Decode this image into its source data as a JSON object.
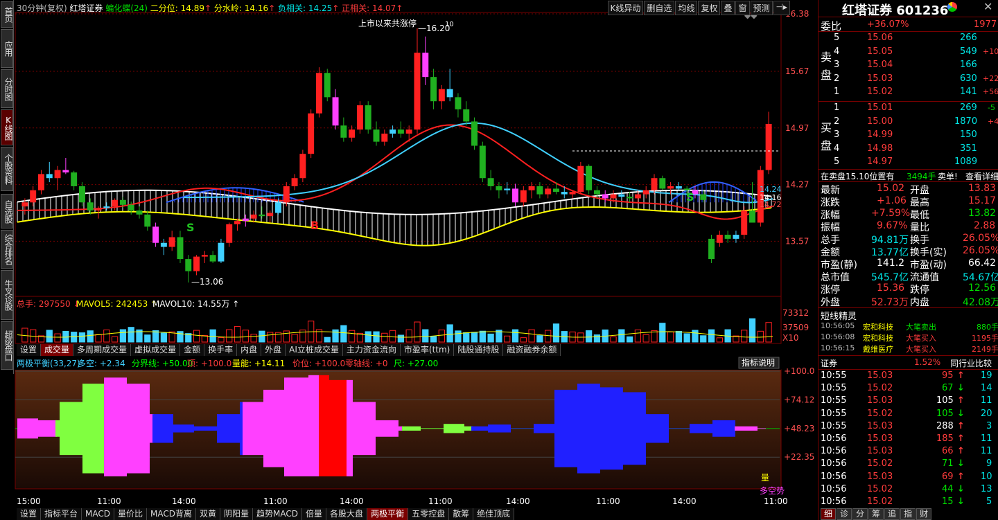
{
  "left_tabs": [
    "首页",
    "应用",
    "分时图",
    "K线图",
    "个股资料",
    "自选股",
    "综合排名",
    "牛叉诊股",
    "超级盘口"
  ],
  "header": {
    "period": "30分钟(复权)",
    "stock": "红塔证券",
    "butterfly": "蝙化蝶(24)",
    "erfen": "二分位: 14.89",
    "fenshui": "分水岭: 14.16",
    "fuxiang": "负相关: 14.25",
    "zhengxiang": "正相关: 14.07"
  },
  "top_buttons": [
    "K线异动",
    "删自选",
    "均线",
    "复权",
    "叠",
    "窗",
    "预测"
  ],
  "price_axis": [
    "16.38",
    "15.67",
    "14.97",
    "14.27",
    "13.57"
  ],
  "annotations": {
    "high": "16.20",
    "high_sup": "10",
    "low": "13.06",
    "listed": "上市以来共涨停",
    "right1": "14.24",
    "right2": "14.16",
    "right3": "14.72",
    "S1": "S",
    "S2": "S",
    "B": "B"
  },
  "volume": {
    "label": "总手: 297550",
    "mavol5": "MAVOL5: 242453",
    "mavol10": "MAVOL10: 14.55万",
    "axis1": "73312",
    "axis2": "37509",
    "axis3": "X10"
  },
  "mid_tabs": [
    "设置",
    "成交量",
    "多周期成交量",
    "虚拟成交量",
    "金额",
    "换手率",
    "内盘",
    "外盘",
    "AI立桩成交量",
    "主力资金流向",
    "市盈率(ttm)",
    "陆股通持股",
    "融资融券余额"
  ],
  "indicator": {
    "name": "两极平衡(33,27)",
    "duokong": "多空: +2.34",
    "fenjie": "分界线: +50.00",
    "ding": "顶: +100.0",
    "liangneng": "量能: +14.11",
    "jiawei": "价位: +100.0",
    "lingzhou": "零轴线: +0",
    "chi": "尺: +27.00",
    "explain": "指标说明",
    "axis": [
      "+100.0",
      "+74.12",
      "+48.23",
      "+22.35"
    ],
    "tag1": "量",
    "tag2": "多空势"
  },
  "time_axis": [
    "15:00",
    "11:00",
    "14:00",
    "11:00",
    "14:00",
    "11:00",
    "14:00",
    "11:00",
    "14:00",
    "11:00"
  ],
  "bottom_tabs": [
    "设置",
    "指标平台",
    "MACD",
    "量价比",
    "MACD背离",
    "双黄",
    "阴阳量",
    "趋势MACD",
    "倍量",
    "各股大盘",
    "两极平衡",
    "五零控盘",
    "散筹",
    "绝佳顶底"
  ],
  "right": {
    "title": "红塔证券 601236",
    "weibi": {
      "label": "委比",
      "pct": "+36.07%",
      "val": "1977"
    },
    "sell_label": "卖盘",
    "buy_label": "买盘",
    "asks": [
      [
        "5",
        "15.06",
        "266",
        ""
      ],
      [
        "4",
        "15.05",
        "549",
        "+10"
      ],
      [
        "3",
        "15.04",
        "166",
        ""
      ],
      [
        "2",
        "15.03",
        "630",
        "+22"
      ],
      [
        "1",
        "15.02",
        "141",
        "+56"
      ]
    ],
    "bids": [
      [
        "1",
        "15.01",
        "269",
        "-5"
      ],
      [
        "2",
        "15.00",
        "1870",
        "+4"
      ],
      [
        "3",
        "14.99",
        "150",
        ""
      ],
      [
        "4",
        "14.98",
        "351",
        ""
      ],
      [
        "5",
        "14.97",
        "1089",
        ""
      ]
    ],
    "note": "在卖盘15.10位置有",
    "note_val": "3494手",
    "note_tag": "卖单!",
    "note_link": "查看详细",
    "stats": [
      [
        "最新",
        "15.02",
        "开盘",
        "13.83"
      ],
      [
        "涨跌",
        "+1.06",
        "最高",
        "15.17"
      ],
      [
        "涨幅",
        "+7.59%",
        "最低",
        "13.82"
      ],
      [
        "振幅",
        "9.67%",
        "量比",
        "2.88"
      ],
      [
        "总手",
        "94.81万",
        "换手",
        "26.05%"
      ],
      [
        "金额",
        "13.77亿",
        "换手(实)",
        "26.05%"
      ],
      [
        "市盈(静)",
        "141.2",
        "市盈(动)",
        "66.42"
      ],
      [
        "总市值",
        "545.7亿",
        "流通值",
        "54.67亿"
      ],
      [
        "涨停",
        "15.36",
        "跌停",
        "12.56"
      ],
      [
        "外盘",
        "52.73万",
        "内盘",
        "42.08万"
      ]
    ],
    "elf_title": "短线精灵",
    "elf": [
      [
        "10:56:05",
        "宏和科技",
        "大笔卖出",
        "880手"
      ],
      [
        "10:56:08",
        "宏和科技",
        "大笔买入",
        "1195手"
      ],
      [
        "10:56:15",
        "戴维医疗",
        "大笔买入",
        "2149手"
      ]
    ],
    "sector": {
      "name": "证券",
      "pct": "1.52%",
      "link": "同行业比较"
    },
    "ticks": [
      [
        "10:55",
        "15.03",
        "95",
        "19"
      ],
      [
        "10:55",
        "15.02",
        "67",
        "14"
      ],
      [
        "10:55",
        "15.03",
        "105",
        "11"
      ],
      [
        "10:55",
        "15.02",
        "105",
        "20"
      ],
      [
        "10:55",
        "15.03",
        "288",
        "3"
      ],
      [
        "10:56",
        "15.03",
        "185",
        "11"
      ],
      [
        "10:56",
        "15.03",
        "66",
        "11"
      ],
      [
        "10:56",
        "15.02",
        "71",
        "9"
      ],
      [
        "10:56",
        "15.03",
        "69",
        "10"
      ],
      [
        "10:56",
        "15.02",
        "44",
        "13"
      ],
      [
        "10:56",
        "15.02",
        "15",
        "5"
      ]
    ],
    "bottom_tabs": [
      "细",
      "诊",
      "分",
      "筹",
      "追",
      "指",
      "财"
    ]
  },
  "chart_data": {
    "type": "candlestick",
    "ylim": [
      13.0,
      16.38
    ],
    "candles": [
      [
        14.0,
        14.1,
        13.9,
        14.05
      ],
      [
        14.05,
        14.25,
        14.0,
        14.2
      ],
      [
        14.2,
        14.45,
        14.15,
        14.4
      ],
      [
        14.4,
        14.55,
        14.3,
        14.35
      ],
      [
        14.35,
        14.5,
        14.2,
        14.45
      ],
      [
        14.45,
        14.6,
        14.4,
        14.42
      ],
      [
        14.42,
        14.44,
        14.2,
        14.25
      ],
      [
        14.25,
        14.3,
        14.0,
        14.05
      ],
      [
        14.05,
        14.1,
        13.9,
        13.95
      ],
      [
        13.95,
        14.0,
        13.85,
        13.98
      ],
      [
        13.98,
        14.05,
        13.95,
        14.0
      ],
      [
        14.0,
        14.1,
        13.95,
        14.08
      ],
      [
        14.08,
        14.12,
        13.98,
        14.02
      ],
      [
        14.02,
        14.06,
        13.9,
        13.95
      ],
      [
        13.95,
        14.0,
        13.85,
        13.9
      ],
      [
        13.9,
        13.95,
        13.7,
        13.75
      ],
      [
        13.75,
        13.8,
        13.5,
        13.55
      ],
      [
        13.55,
        13.6,
        13.4,
        13.5
      ],
      [
        13.5,
        13.7,
        13.45,
        13.62
      ],
      [
        13.62,
        13.7,
        13.3,
        13.35
      ],
      [
        13.35,
        13.4,
        13.06,
        13.2
      ],
      [
        13.2,
        13.4,
        13.15,
        13.38
      ],
      [
        13.38,
        13.45,
        13.3,
        13.4
      ],
      [
        13.4,
        13.45,
        13.3,
        13.32
      ],
      [
        13.32,
        13.6,
        13.3,
        13.55
      ],
      [
        13.55,
        13.8,
        13.5,
        13.78
      ],
      [
        13.78,
        13.85,
        13.7,
        13.82
      ],
      [
        13.82,
        13.9,
        13.75,
        13.85
      ],
      [
        13.85,
        13.95,
        13.8,
        13.9
      ],
      [
        13.9,
        14.0,
        13.85,
        13.88
      ],
      [
        13.88,
        13.95,
        13.8,
        13.92
      ],
      [
        13.92,
        14.1,
        13.9,
        14.05
      ],
      [
        14.05,
        14.3,
        14.0,
        14.25
      ],
      [
        14.25,
        14.4,
        14.2,
        14.35
      ],
      [
        14.35,
        14.7,
        14.3,
        14.65
      ],
      [
        14.65,
        15.2,
        14.6,
        15.15
      ],
      [
        15.15,
        15.72,
        15.1,
        15.65
      ],
      [
        15.65,
        15.7,
        15.3,
        15.35
      ],
      [
        15.35,
        15.45,
        14.95,
        15.0
      ],
      [
        15.0,
        15.1,
        14.8,
        14.85
      ],
      [
        14.85,
        15.0,
        14.8,
        14.95
      ],
      [
        14.95,
        15.3,
        14.9,
        15.25
      ],
      [
        15.25,
        15.3,
        14.9,
        14.95
      ],
      [
        14.95,
        15.05,
        14.75,
        14.8
      ],
      [
        14.8,
        14.95,
        14.75,
        14.9
      ],
      [
        14.9,
        15.0,
        14.85,
        14.95
      ],
      [
        14.95,
        15.05,
        14.85,
        14.9
      ],
      [
        14.9,
        15.0,
        14.8,
        14.95
      ],
      [
        14.95,
        16.2,
        14.9,
        15.9
      ],
      [
        15.9,
        16.1,
        15.5,
        15.6
      ],
      [
        15.6,
        15.7,
        15.2,
        15.3
      ],
      [
        15.3,
        15.5,
        15.2,
        15.45
      ],
      [
        15.45,
        15.7,
        15.3,
        15.35
      ],
      [
        15.35,
        15.4,
        15.1,
        15.2
      ],
      [
        15.2,
        15.3,
        15.0,
        15.05
      ],
      [
        15.05,
        15.1,
        14.7,
        14.75
      ],
      [
        14.75,
        14.8,
        14.3,
        14.35
      ],
      [
        14.35,
        14.45,
        14.2,
        14.25
      ],
      [
        14.25,
        14.3,
        14.1,
        14.2
      ],
      [
        14.2,
        14.3,
        14.15,
        14.22
      ],
      [
        14.22,
        14.28,
        14.0,
        14.05
      ],
      [
        14.05,
        14.25,
        14.0,
        14.2
      ],
      [
        14.2,
        14.3,
        14.1,
        14.25
      ],
      [
        14.25,
        14.3,
        14.1,
        14.15
      ],
      [
        14.15,
        14.25,
        14.1,
        14.22
      ],
      [
        14.22,
        14.3,
        14.15,
        14.18
      ],
      [
        14.18,
        14.25,
        14.1,
        14.15
      ],
      [
        14.15,
        14.2,
        14.1,
        14.18
      ],
      [
        14.18,
        14.55,
        14.15,
        14.5
      ],
      [
        14.5,
        14.52,
        14.15,
        14.2
      ],
      [
        14.2,
        14.25,
        14.1,
        14.15
      ],
      [
        14.15,
        14.2,
        14.05,
        14.1
      ],
      [
        14.1,
        14.2,
        14.05,
        14.15
      ],
      [
        14.15,
        14.2,
        14.1,
        14.12
      ],
      [
        14.12,
        14.18,
        14.05,
        14.1
      ],
      [
        14.1,
        14.2,
        14.05,
        14.15
      ],
      [
        14.15,
        14.25,
        14.1,
        14.2
      ],
      [
        14.2,
        14.4,
        14.15,
        14.35
      ],
      [
        14.35,
        14.38,
        14.2,
        14.22
      ],
      [
        14.22,
        14.3,
        14.15,
        14.25
      ],
      [
        14.25,
        14.3,
        14.2,
        14.22
      ],
      [
        14.22,
        14.25,
        14.15,
        14.2
      ],
      [
        14.2,
        14.25,
        14.1,
        14.15
      ],
      [
        14.15,
        14.2,
        14.05,
        14.08
      ],
      [
        13.6,
        13.65,
        13.3,
        13.35
      ],
      [
        13.55,
        13.7,
        13.5,
        13.65
      ],
      [
        13.65,
        13.7,
        13.55,
        13.6
      ],
      [
        13.6,
        13.7,
        13.55,
        13.65
      ],
      [
        13.65,
        14.0,
        13.6,
        13.95
      ],
      [
        13.95,
        14.3,
        13.9,
        13.8
      ],
      [
        13.8,
        14.5,
        13.75,
        14.45
      ],
      [
        14.45,
        15.17,
        14.4,
        15.02
      ]
    ],
    "ma_red": [
      13.95,
      14.0,
      14.05,
      14.05,
      14.1,
      14.1,
      14.05,
      14.02,
      14.0,
      13.98,
      13.97,
      13.96
    ],
    "ma_cyan": [
      14.2,
      14.18,
      14.15,
      14.1,
      14.05,
      14.0,
      13.98
    ],
    "series": [
      {
        "name": "两极平衡",
        "values": [
          40,
          55,
          70,
          85,
          90,
          85,
          60,
          45,
          50,
          60,
          70,
          80,
          90,
          92,
          88,
          70,
          55,
          50,
          48,
          52,
          50,
          45,
          48,
          52,
          80,
          85,
          82,
          78,
          60,
          48,
          52,
          55,
          50,
          48
        ]
      }
    ]
  }
}
